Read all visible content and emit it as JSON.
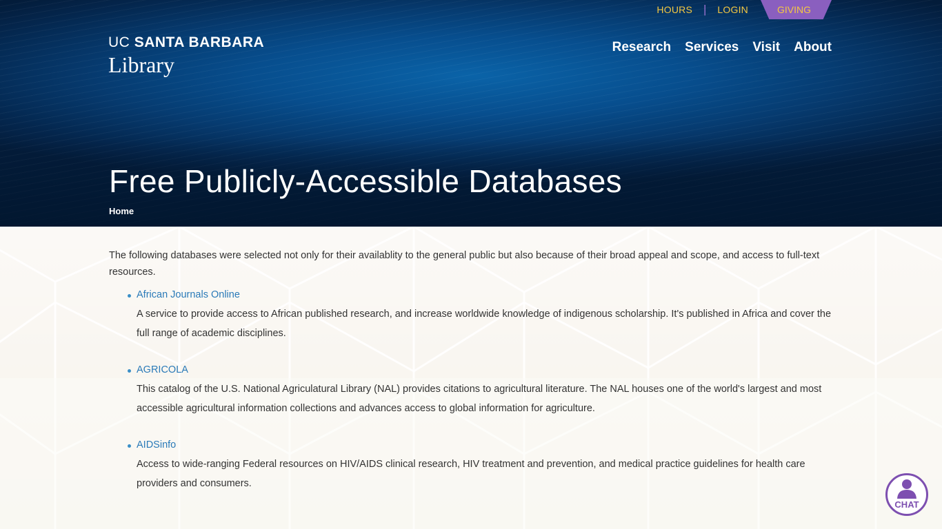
{
  "utility_nav": {
    "hours": "HOURS",
    "login": "LOGIN",
    "giving": "GIVING"
  },
  "logo": {
    "line1_prefix": "UC",
    "line1_name": "SANTA BARBARA",
    "line2": "Library"
  },
  "main_nav": [
    "Research",
    "Services",
    "Visit",
    "About"
  ],
  "page": {
    "title": "Free Publicly-Accessible Databases",
    "breadcrumb": "Home"
  },
  "content": {
    "intro": "The following databases were selected not only for their availablity to the general public but also because of their broad appeal and scope, and access to full-text resources.",
    "databases": [
      {
        "name": "African Journals Online",
        "description": "A service to provide access to African published research, and increase worldwide knowledge of indigenous scholarship. It's published in Africa and cover the full range of academic disciplines."
      },
      {
        "name": "AGRICOLA",
        "description": "This catalog of the U.S. National Agriculatural Library (NAL) provides citations to agricultural literature. The NAL houses one of the world's largest and most accessible agricultural information collections and advances access to global information for agriculture."
      },
      {
        "name": "AIDSinfo",
        "description": "Access to wide-ranging Federal resources on HIV/AIDS clinical research, HIV treatment and prevention, and medical practice guidelines for health care providers and consumers."
      }
    ]
  },
  "chat": {
    "label": "CHAT",
    "icon": "person-icon"
  },
  "colors": {
    "accent_gold": "#f5c842",
    "accent_purple": "#8a5fbf",
    "link_blue": "#2a7ab8",
    "hero_blue": "#0a63a8"
  }
}
